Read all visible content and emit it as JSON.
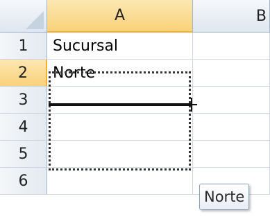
{
  "columns": {
    "a": "A",
    "b": "B"
  },
  "rows": [
    {
      "num": "1",
      "a": "Sucursal",
      "b": ""
    },
    {
      "num": "2",
      "a": "Norte",
      "b": ""
    },
    {
      "num": "3",
      "a": "",
      "b": ""
    },
    {
      "num": "4",
      "a": "",
      "b": ""
    },
    {
      "num": "5",
      "a": "",
      "b": ""
    },
    {
      "num": "6",
      "a": "",
      "b": ""
    }
  ],
  "active_row": "2",
  "active_column": "A",
  "fill_tooltip": "Norte",
  "colors": {
    "header_active": "#f9d27a",
    "header_default": "#dfe6ef",
    "gridline": "#d0d7e5",
    "header_border": "#9eb6ce"
  }
}
